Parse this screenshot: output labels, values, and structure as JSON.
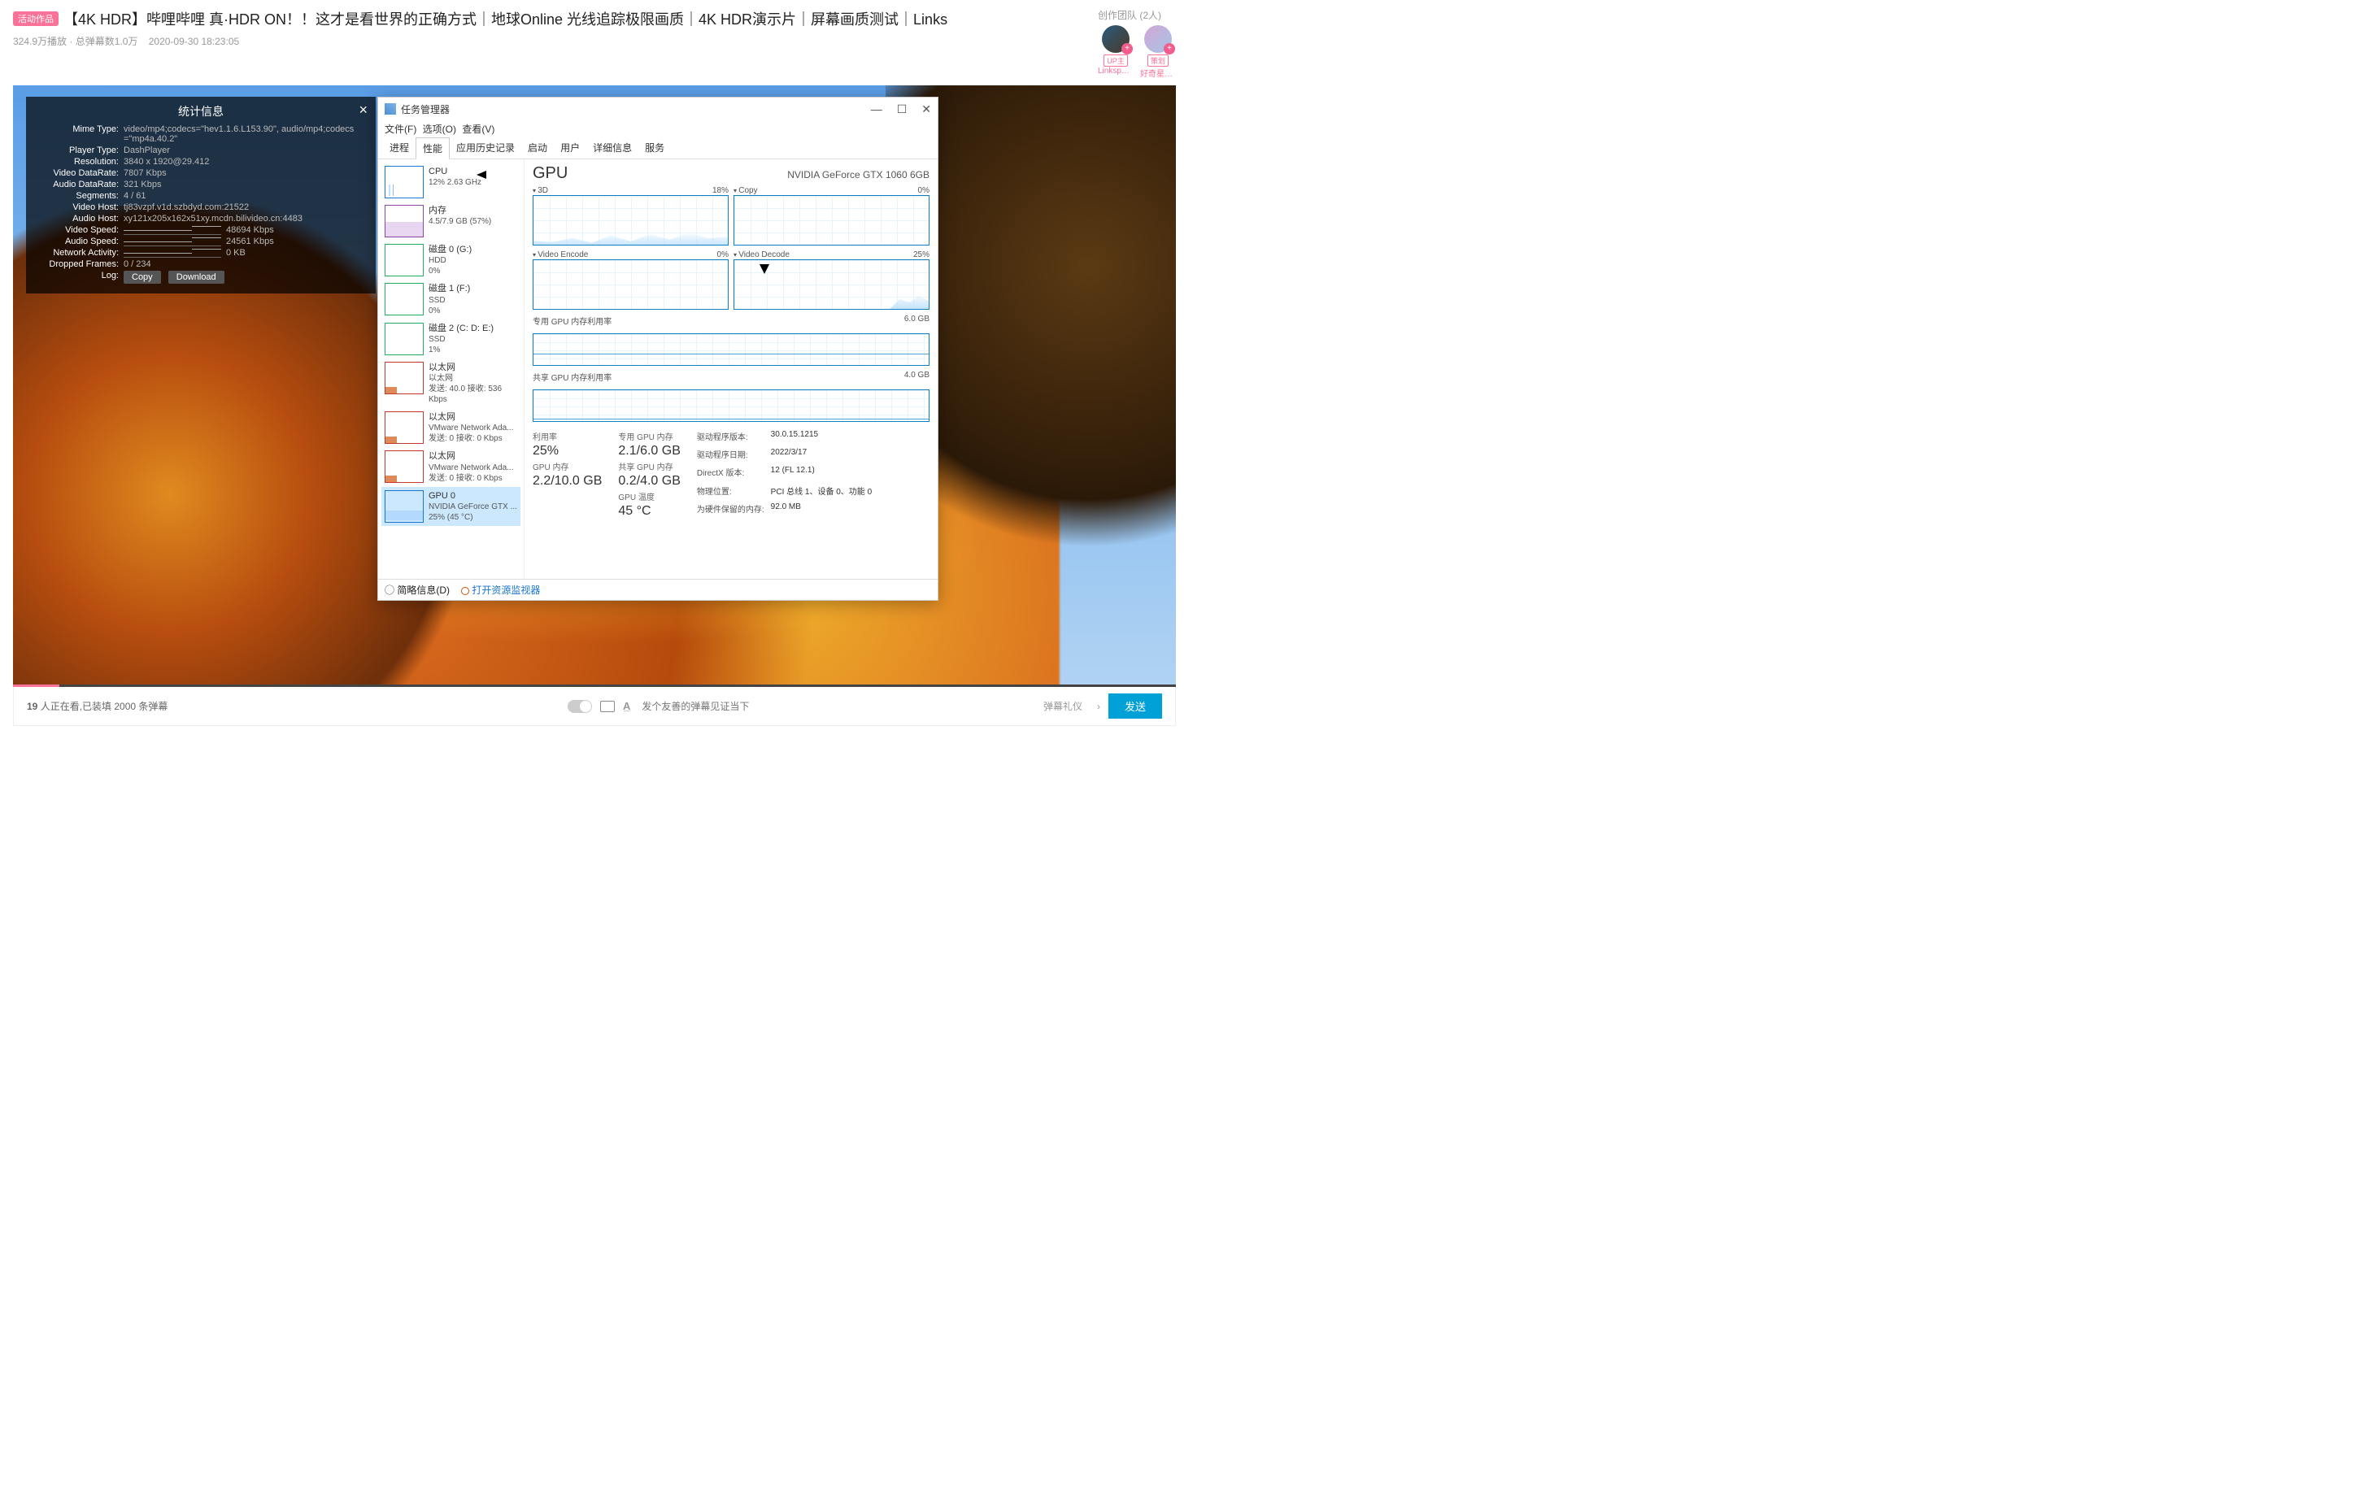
{
  "bili": {
    "badge": "活动作品",
    "title": "【4K HDR】哔哩哔哩 真·HDR ON！！这才是看世界的正确方式｜地球Online 光线追踪极限画质｜4K HDR演示片｜屏幕画质测试｜Links",
    "meta_plays": "324.9万播放 · 总弹幕数1.0万",
    "meta_date": "2020-09-30 18:23:05",
    "team_title": "创作团队 (2人)",
    "users": [
      {
        "tag": "UP主",
        "name": "Linksph…"
      },
      {
        "tag": "策划",
        "name": "好奇星人…"
      }
    ]
  },
  "stats": {
    "title": "统计信息",
    "rows": {
      "mime": {
        "label": "Mime Type:",
        "val": "video/mp4;codecs=\"hev1.1.6.L153.90\", audio/mp4;codecs=\"mp4a.40.2\""
      },
      "player": {
        "label": "Player Type:",
        "val": "DashPlayer"
      },
      "res": {
        "label": "Resolution:",
        "val": "3840 x 1920@29.412"
      },
      "vdr": {
        "label": "Video DataRate:",
        "val": "7807 Kbps"
      },
      "adr": {
        "label": "Audio DataRate:",
        "val": "321 Kbps"
      },
      "seg": {
        "label": "Segments:",
        "val": "4 / 61"
      },
      "vh": {
        "label": "Video Host:",
        "val": "tj83vzpf.v1d.szbdyd.com:21522"
      },
      "ah": {
        "label": "Audio Host:",
        "val": "xy121x205x162x51xy.mcdn.bilivideo.cn:4483"
      },
      "vs": {
        "label": "Video Speed:",
        "val": "48694 Kbps"
      },
      "as": {
        "label": "Audio Speed:",
        "val": "24561 Kbps"
      },
      "na": {
        "label": "Network Activity:",
        "val": "0 KB"
      },
      "df": {
        "label": "Dropped Frames:",
        "val": "0 / 234"
      },
      "log": {
        "label": "Log:"
      }
    },
    "btn_copy": "Copy",
    "btn_download": "Download"
  },
  "tm": {
    "title": "任务管理器",
    "menu": [
      "文件(F)",
      "选项(O)",
      "查看(V)"
    ],
    "tabs": [
      "进程",
      "性能",
      "应用历史记录",
      "启动",
      "用户",
      "详细信息",
      "服务"
    ],
    "side": [
      {
        "name": "CPU",
        "sub": "12%  2.63 GHz",
        "thumb": "cpu"
      },
      {
        "name": "内存",
        "sub": "4.5/7.9 GB (57%)",
        "thumb": "mem"
      },
      {
        "name": "磁盘 0 (G:)",
        "sub": "HDD\n0%",
        "thumb": "disk"
      },
      {
        "name": "磁盘 1 (F:)",
        "sub": "SSD\n0%",
        "thumb": "disk"
      },
      {
        "name": "磁盘 2 (C: D: E:)",
        "sub": "SSD\n1%",
        "thumb": "disk"
      },
      {
        "name": "以太网",
        "sub": "以太网\n发送: 40.0 接收: 536 Kbps",
        "thumb": "eth"
      },
      {
        "name": "以太网",
        "sub": "VMware Network Ada...\n发送: 0 接收: 0 Kbps",
        "thumb": "eth"
      },
      {
        "name": "以太网",
        "sub": "VMware Network Ada...\n发送: 0 接收: 0 Kbps",
        "thumb": "eth"
      },
      {
        "name": "GPU 0",
        "sub": "NVIDIA GeForce GTX ...\n25%  (45 °C)",
        "thumb": "gpu"
      }
    ],
    "briefinfo": "简略信息(D)",
    "resmon": "打开资源监视器"
  },
  "gpu": {
    "heading": "GPU",
    "name": "NVIDIA GeForce GTX 1060 6GB",
    "charts": {
      "c3d": {
        "label": "3D",
        "pct": "18%"
      },
      "copy": {
        "label": "Copy",
        "pct": "0%"
      },
      "venc": {
        "label": "Video Encode",
        "pct": "0%"
      },
      "vdec": {
        "label": "Video Decode",
        "pct": "25%"
      }
    },
    "ded_mem_label": "专用 GPU 内存利用率",
    "ded_mem_max": "6.0 GB",
    "shr_mem_label": "共享 GPU 内存利用率",
    "shr_mem_max": "4.0 GB",
    "stats": {
      "util_lbl": "利用率",
      "util": "25%",
      "gpumem_lbl": "GPU 内存",
      "gpumem": "2.2/10.0 GB",
      "ded_lbl": "专用 GPU 内存",
      "ded": "2.1/6.0 GB",
      "shr_lbl": "共享 GPU 内存",
      "shr": "0.2/4.0 GB",
      "temp_lbl": "GPU 温度",
      "temp": "45 °C"
    },
    "info": {
      "drvver_lbl": "驱动程序版本:",
      "drvver": "30.0.15.1215",
      "drvdate_lbl": "驱动程序日期:",
      "drvdate": "2022/3/17",
      "dx_lbl": "DirectX 版本:",
      "dx": "12 (FL 12.1)",
      "loc_lbl": "物理位置:",
      "loc": "PCI 总线 1、设备 0、功能 0",
      "hw_lbl": "为硬件保留的内存:",
      "hw": "92.0 MB"
    }
  },
  "chart_data": [
    {
      "type": "area",
      "title": "3D",
      "values": [
        5,
        4,
        8,
        6,
        12,
        7,
        15,
        18,
        10,
        14,
        9,
        16,
        12,
        18,
        15
      ],
      "ylim": [
        0,
        100
      ]
    },
    {
      "type": "area",
      "title": "Copy",
      "values": [
        0,
        0,
        0,
        0,
        0,
        0,
        0,
        0,
        0,
        0
      ],
      "ylim": [
        0,
        100
      ]
    },
    {
      "type": "area",
      "title": "Video Encode",
      "values": [
        0,
        0,
        0,
        0,
        0,
        0,
        0,
        0,
        0,
        0
      ],
      "ylim": [
        0,
        100
      ]
    },
    {
      "type": "area",
      "title": "Video Decode",
      "values": [
        0,
        0,
        0,
        0,
        0,
        0,
        0,
        0,
        0,
        0,
        15,
        25,
        20,
        28,
        25
      ],
      "ylim": [
        0,
        100
      ]
    },
    {
      "type": "line",
      "title": "专用 GPU 内存利用率",
      "values": [
        2.0,
        2.0,
        2.0,
        2.1,
        2.1,
        2.1,
        2.1,
        2.1
      ],
      "ylim": [
        0,
        6.0
      ],
      "ylabel": "GB"
    },
    {
      "type": "line",
      "title": "共享 GPU 内存利用率",
      "values": [
        0.2,
        0.2,
        0.2,
        0.2,
        0.2,
        0.2,
        0.2,
        0.2
      ],
      "ylim": [
        0,
        4.0
      ],
      "ylabel": "GB"
    }
  ],
  "danmaku": {
    "count_pre": "19",
    "count_txt": "人正在看,已装填 2000 条弹幕",
    "placeholder": "发个友善的弹幕见证当下",
    "gift": "弹幕礼仪",
    "send": "发送"
  }
}
